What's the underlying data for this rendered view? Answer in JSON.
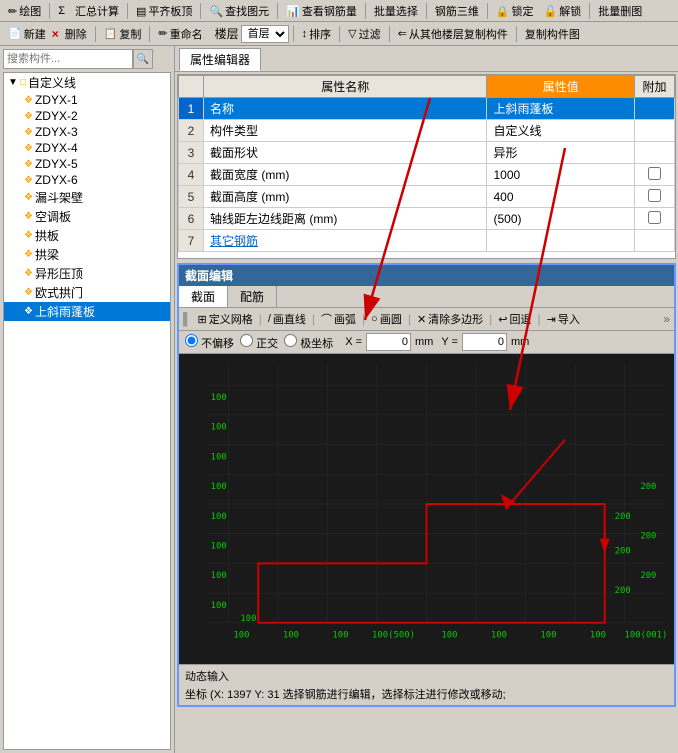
{
  "toolbar_top": {
    "items": [
      {
        "label": "绘图",
        "icon": "pencil"
      },
      {
        "label": "Σ",
        "icon": "sigma"
      },
      {
        "label": "汇总计算",
        "icon": "calc"
      },
      {
        "label": "平齐板顶",
        "icon": "align"
      },
      {
        "label": "查找图元",
        "icon": "find"
      },
      {
        "label": "查看钢筋量",
        "icon": "view"
      },
      {
        "label": "批量选择",
        "icon": "batch"
      },
      {
        "label": "钢筋三维",
        "icon": "3d"
      },
      {
        "label": "锁定",
        "icon": "lock"
      },
      {
        "label": "解锁",
        "icon": "unlock"
      },
      {
        "label": "批量删图",
        "icon": "delete"
      }
    ]
  },
  "toolbar_second": {
    "new_label": "新建",
    "delete_label": "删除",
    "copy_label": "复制",
    "rename_label": "重命名",
    "layer_label": "楼层",
    "floor_value": "首层",
    "sort_label": "排序",
    "filter_label": "过滤",
    "copy_from_label": "从其他楼层复制构件",
    "copy_struct_label": "复制构件图"
  },
  "search": {
    "placeholder": "搜索构件..."
  },
  "tree": {
    "root": "自定义线",
    "items": [
      {
        "id": "ZDYX-1",
        "label": "ZDYX-1"
      },
      {
        "id": "ZDYX-2",
        "label": "ZDYX-2"
      },
      {
        "id": "ZDYX-3",
        "label": "ZDYX-3"
      },
      {
        "id": "ZDYX-4",
        "label": "ZDYX-4"
      },
      {
        "id": "ZDYX-5",
        "label": "ZDYX-5"
      },
      {
        "id": "ZDYX-6",
        "label": "ZDYX-6"
      },
      {
        "id": "漏斗架壁",
        "label": "漏斗架壁"
      },
      {
        "id": "空调板",
        "label": "空调板"
      },
      {
        "id": "拱板",
        "label": "拱板"
      },
      {
        "id": "拱梁",
        "label": "拱梁"
      },
      {
        "id": "异形压顶",
        "label": "异形压顶"
      },
      {
        "id": "欧式拱门",
        "label": "欧式拱门"
      },
      {
        "id": "上斜雨蓬板",
        "label": "上斜雨蓬板"
      }
    ],
    "selected": "上斜雨蓬板"
  },
  "tab": {
    "label": "属性编辑器"
  },
  "property_table": {
    "headers": [
      "属性名称",
      "属性值",
      "附加"
    ],
    "rows": [
      {
        "num": 1,
        "name": "名称",
        "value": "上斜雨蓬板",
        "has_checkbox": false,
        "selected": true
      },
      {
        "num": 2,
        "name": "构件类型",
        "value": "自定义线",
        "has_checkbox": false
      },
      {
        "num": 3,
        "name": "截面形状",
        "value": "异形",
        "has_checkbox": false
      },
      {
        "num": 4,
        "name": "截面宽度 (mm)",
        "value": "1000",
        "has_checkbox": true
      },
      {
        "num": 5,
        "name": "截面高度 (mm)",
        "value": "400",
        "has_checkbox": true
      },
      {
        "num": 6,
        "name": "轴线距左边线距离 (mm)",
        "value": "(500)",
        "has_checkbox": true
      },
      {
        "num": 7,
        "name": "其它钢筋",
        "value": "",
        "has_checkbox": false,
        "is_link": true
      }
    ]
  },
  "editor": {
    "title": "截面编辑",
    "tabs": [
      "截面",
      "配筋"
    ],
    "active_tab": "截面",
    "toolbar_items": [
      {
        "label": "定义网格",
        "icon": "grid"
      },
      {
        "label": "画直线",
        "icon": "line"
      },
      {
        "label": "画弧",
        "icon": "arc"
      },
      {
        "label": "画圆",
        "icon": "circle"
      },
      {
        "label": "清除多边形",
        "icon": "clear"
      },
      {
        "label": "回退",
        "icon": "undo"
      },
      {
        "label": "导入",
        "icon": "import"
      }
    ],
    "coords": {
      "mode_options": [
        "不偏移",
        "正交",
        "极坐标"
      ],
      "selected_mode": "不偏移",
      "x_label": "X =",
      "x_value": "0",
      "x_unit": "mm",
      "y_label": "Y =",
      "y_value": "0",
      "y_unit": "mm"
    },
    "grid_labels_x": [
      "100",
      "100",
      "100",
      "100(500)",
      "100",
      "100",
      "100",
      "100",
      "100(001)"
    ],
    "grid_labels_y": [
      "100",
      "100",
      "100",
      "100",
      "100",
      "100",
      "200",
      "200",
      "200"
    ],
    "status_input": "动态输入",
    "status_coord": "坐标 (X: 1397 Y: 31  选择钢筋进行编辑，选择标注进行修改或移动;"
  }
}
